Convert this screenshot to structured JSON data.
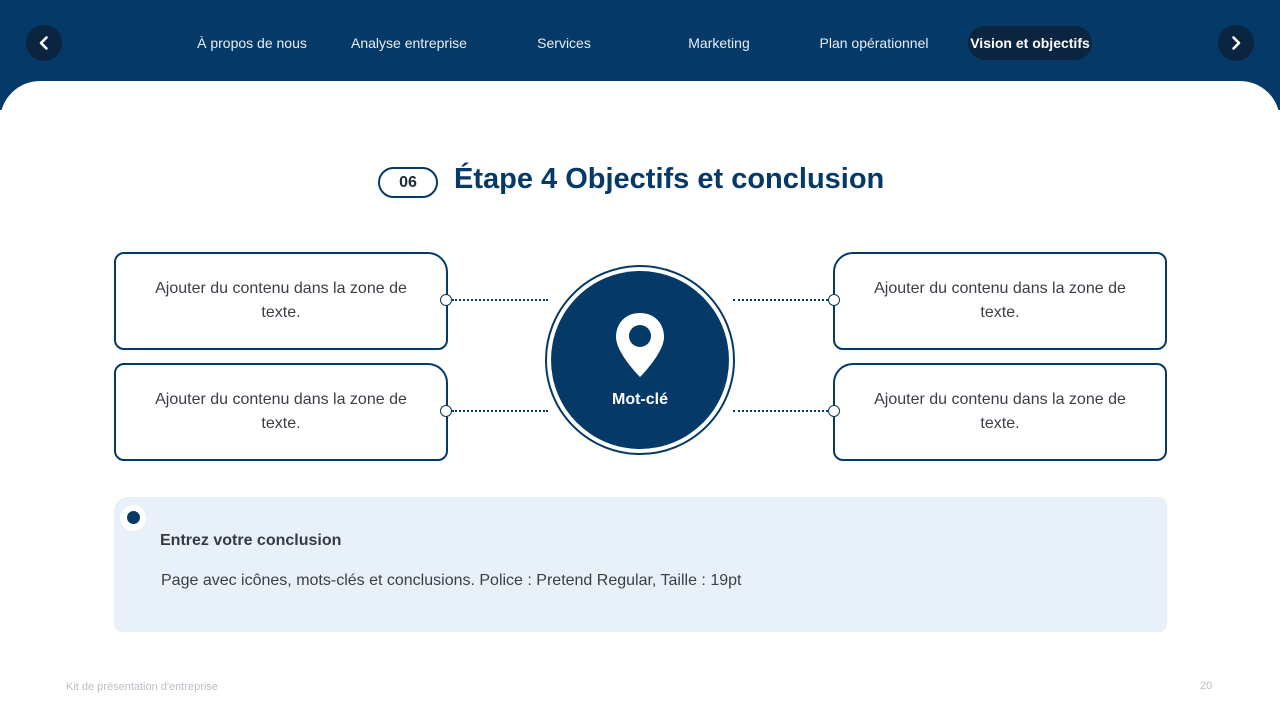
{
  "nav": {
    "prev_icon": "chevron-left-icon",
    "next_icon": "chevron-right-icon",
    "tabs": [
      {
        "label": "À propos de nous"
      },
      {
        "label": "Analyse entreprise"
      },
      {
        "label": "Services"
      },
      {
        "label": "Marketing"
      },
      {
        "label": "Plan opérationnel"
      },
      {
        "label": "Vision et objectifs"
      }
    ],
    "active_tab": "Vision et objectifs"
  },
  "header": {
    "step_number": "06",
    "title": "Étape 4 Objectifs et conclusion"
  },
  "boxes": {
    "top_left": "Ajouter du contenu dans la zone de texte.",
    "bottom_left": "Ajouter du contenu dans la zone de texte.",
    "top_right": "Ajouter du contenu dans la zone de texte.",
    "bottom_right": "Ajouter du contenu dans la zone de texte."
  },
  "center": {
    "icon": "location-pin-icon",
    "keyword": "Mot-clé"
  },
  "conclusion": {
    "title": "Entrez votre conclusion",
    "body": "Page avec icônes, mots-clés et conclusions. Police : Pretend Regular, Taille : 19pt"
  },
  "footer": {
    "left": "Kit de présentation d'entreprise",
    "page_number": "20"
  },
  "colors": {
    "primary": "#053a68",
    "dark": "#0b2440",
    "conclusion_bg": "#e8f0f9"
  }
}
